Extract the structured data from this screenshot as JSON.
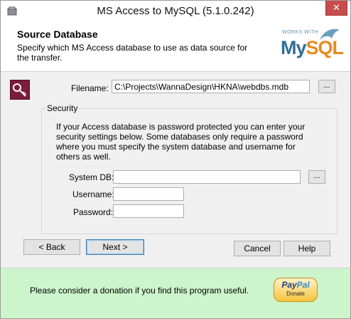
{
  "window": {
    "title": "MS Access to MySQL (5.1.0.242)",
    "close_symbol": "✕"
  },
  "header": {
    "title": "Source Database",
    "subtitle": "Specify which MS Access database to use as data source for the transfer.",
    "logo_top": "WORKS WITH",
    "logo_my": "My",
    "logo_sql": "SQL"
  },
  "form": {
    "filename_label": "Filename:",
    "filename_value": "C:\\Projects\\WannaDesign\\HKNA\\webdbs.mdb",
    "browse_label": "...",
    "security": {
      "legend": "Security",
      "description": "If your Access database is password protected you can enter your security settings below. Some databases only require a password where you must specify the system database and username for others as well.",
      "system_db_label": "System DB:",
      "system_db_value": "",
      "system_db_browse": "...",
      "username_label": "Username:",
      "username_value": "",
      "password_label": "Password:",
      "password_value": ""
    }
  },
  "buttons": {
    "back": "< Back",
    "next": "Next >",
    "cancel": "Cancel",
    "help": "Help"
  },
  "footer": {
    "donation_text": "Please consider a donation if you find this program useful.",
    "paypal_pay": "Pay",
    "paypal_pal": "Pal",
    "paypal_donate": "Donate",
    "background": "#ccf5cc"
  },
  "icons": {
    "app": "database-icon",
    "key": "key-icon",
    "logo": "mysql-logo-icon"
  }
}
